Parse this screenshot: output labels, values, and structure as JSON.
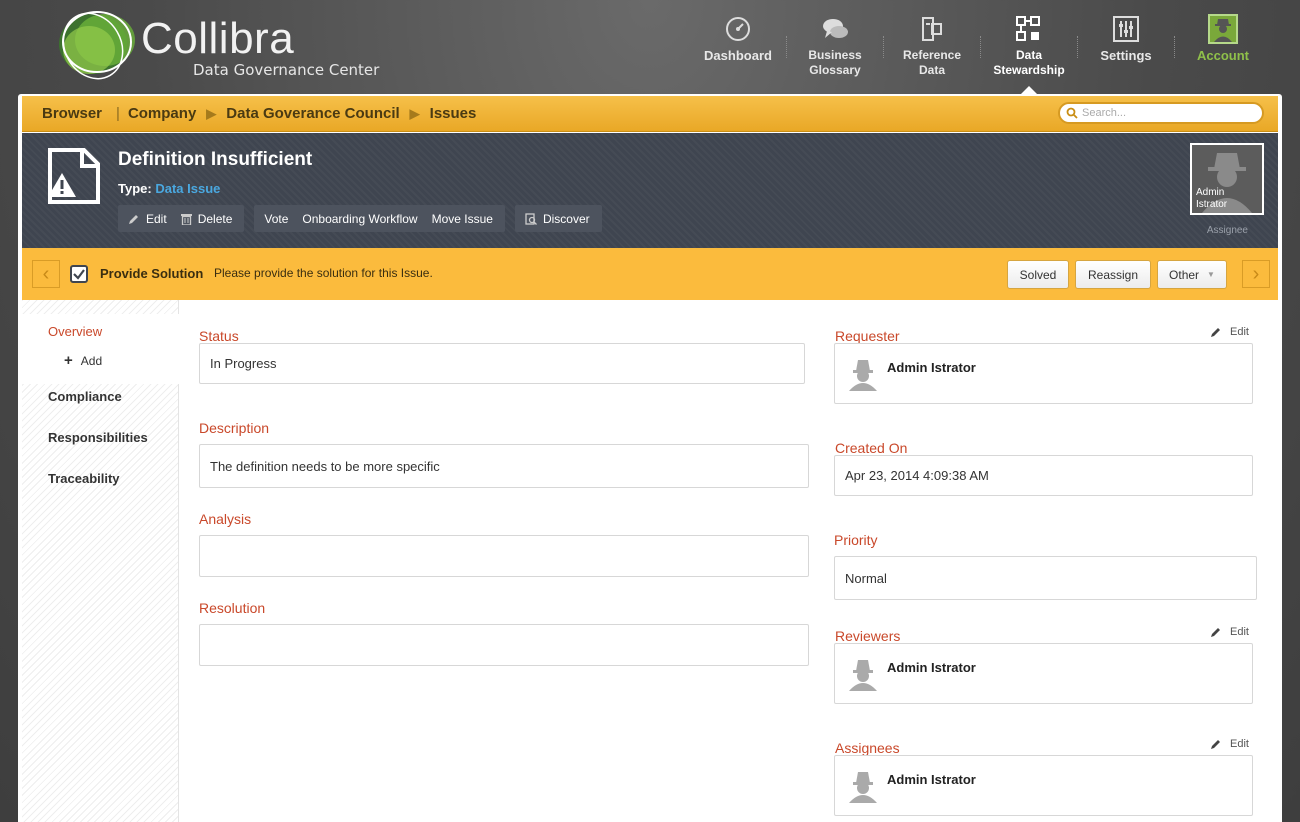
{
  "brand": {
    "title": "Collibra",
    "subtitle": "Data Governance Center"
  },
  "topnav": [
    {
      "label": "Dashboard",
      "icon": "dashboard-icon"
    },
    {
      "label": "Business\nGlossary",
      "icon": "chat-bubbles-icon"
    },
    {
      "label": "Reference\nData",
      "icon": "reference-data-icon"
    },
    {
      "label": "Data\nStewardship",
      "icon": "stewardship-icon"
    },
    {
      "label": "Settings",
      "icon": "sliders-icon"
    },
    {
      "label": "Account",
      "icon": "user-avatar-icon"
    }
  ],
  "breadcrumb": {
    "root": "Browser",
    "items": [
      "Company",
      "Data Goverance Council",
      "Issues"
    ]
  },
  "search": {
    "placeholder": "Search..."
  },
  "asset": {
    "title": "Definition Insufficient",
    "type_label": "Type:",
    "type_value": "Data Issue",
    "actions": {
      "edit": "Edit",
      "delete": "Delete",
      "vote": "Vote",
      "onboarding": "Onboarding Workflow",
      "move": "Move Issue",
      "discover": "Discover"
    },
    "assignee_name": "Admin Istrator",
    "assignee_label": "Assignee"
  },
  "task": {
    "name": "Provide Solution",
    "description": "Please provide the solution for this Issue.",
    "buttons": {
      "solved": "Solved",
      "reassign": "Reassign",
      "other": "Other"
    }
  },
  "sidenav": {
    "overview": "Overview",
    "add": "Add",
    "compliance": "Compliance",
    "responsibilities": "Responsibilities",
    "traceability": "Traceability"
  },
  "fields": {
    "status": {
      "label": "Status",
      "value": "In Progress"
    },
    "description": {
      "label": "Description",
      "value": "The definition needs to be more specific"
    },
    "analysis": {
      "label": "Analysis",
      "value": ""
    },
    "resolution": {
      "label": "Resolution",
      "value": ""
    },
    "requester": {
      "label": "Requester",
      "value": "Admin Istrator"
    },
    "created_on": {
      "label": "Created On",
      "value": "Apr 23, 2014 4:09:38 AM"
    },
    "priority": {
      "label": "Priority",
      "value": "Normal"
    },
    "reviewers": {
      "label": "Reviewers",
      "value": "Admin Istrator"
    },
    "assignees": {
      "label": "Assignees",
      "value": "Admin Istrator"
    }
  },
  "edit_label": "Edit",
  "colors": {
    "accent_orange": "#fbbb3d",
    "label_red": "#c9482a",
    "header_dark": "#3f4550",
    "account_green": "#8fc04a",
    "link_blue": "#4aa8e0"
  }
}
